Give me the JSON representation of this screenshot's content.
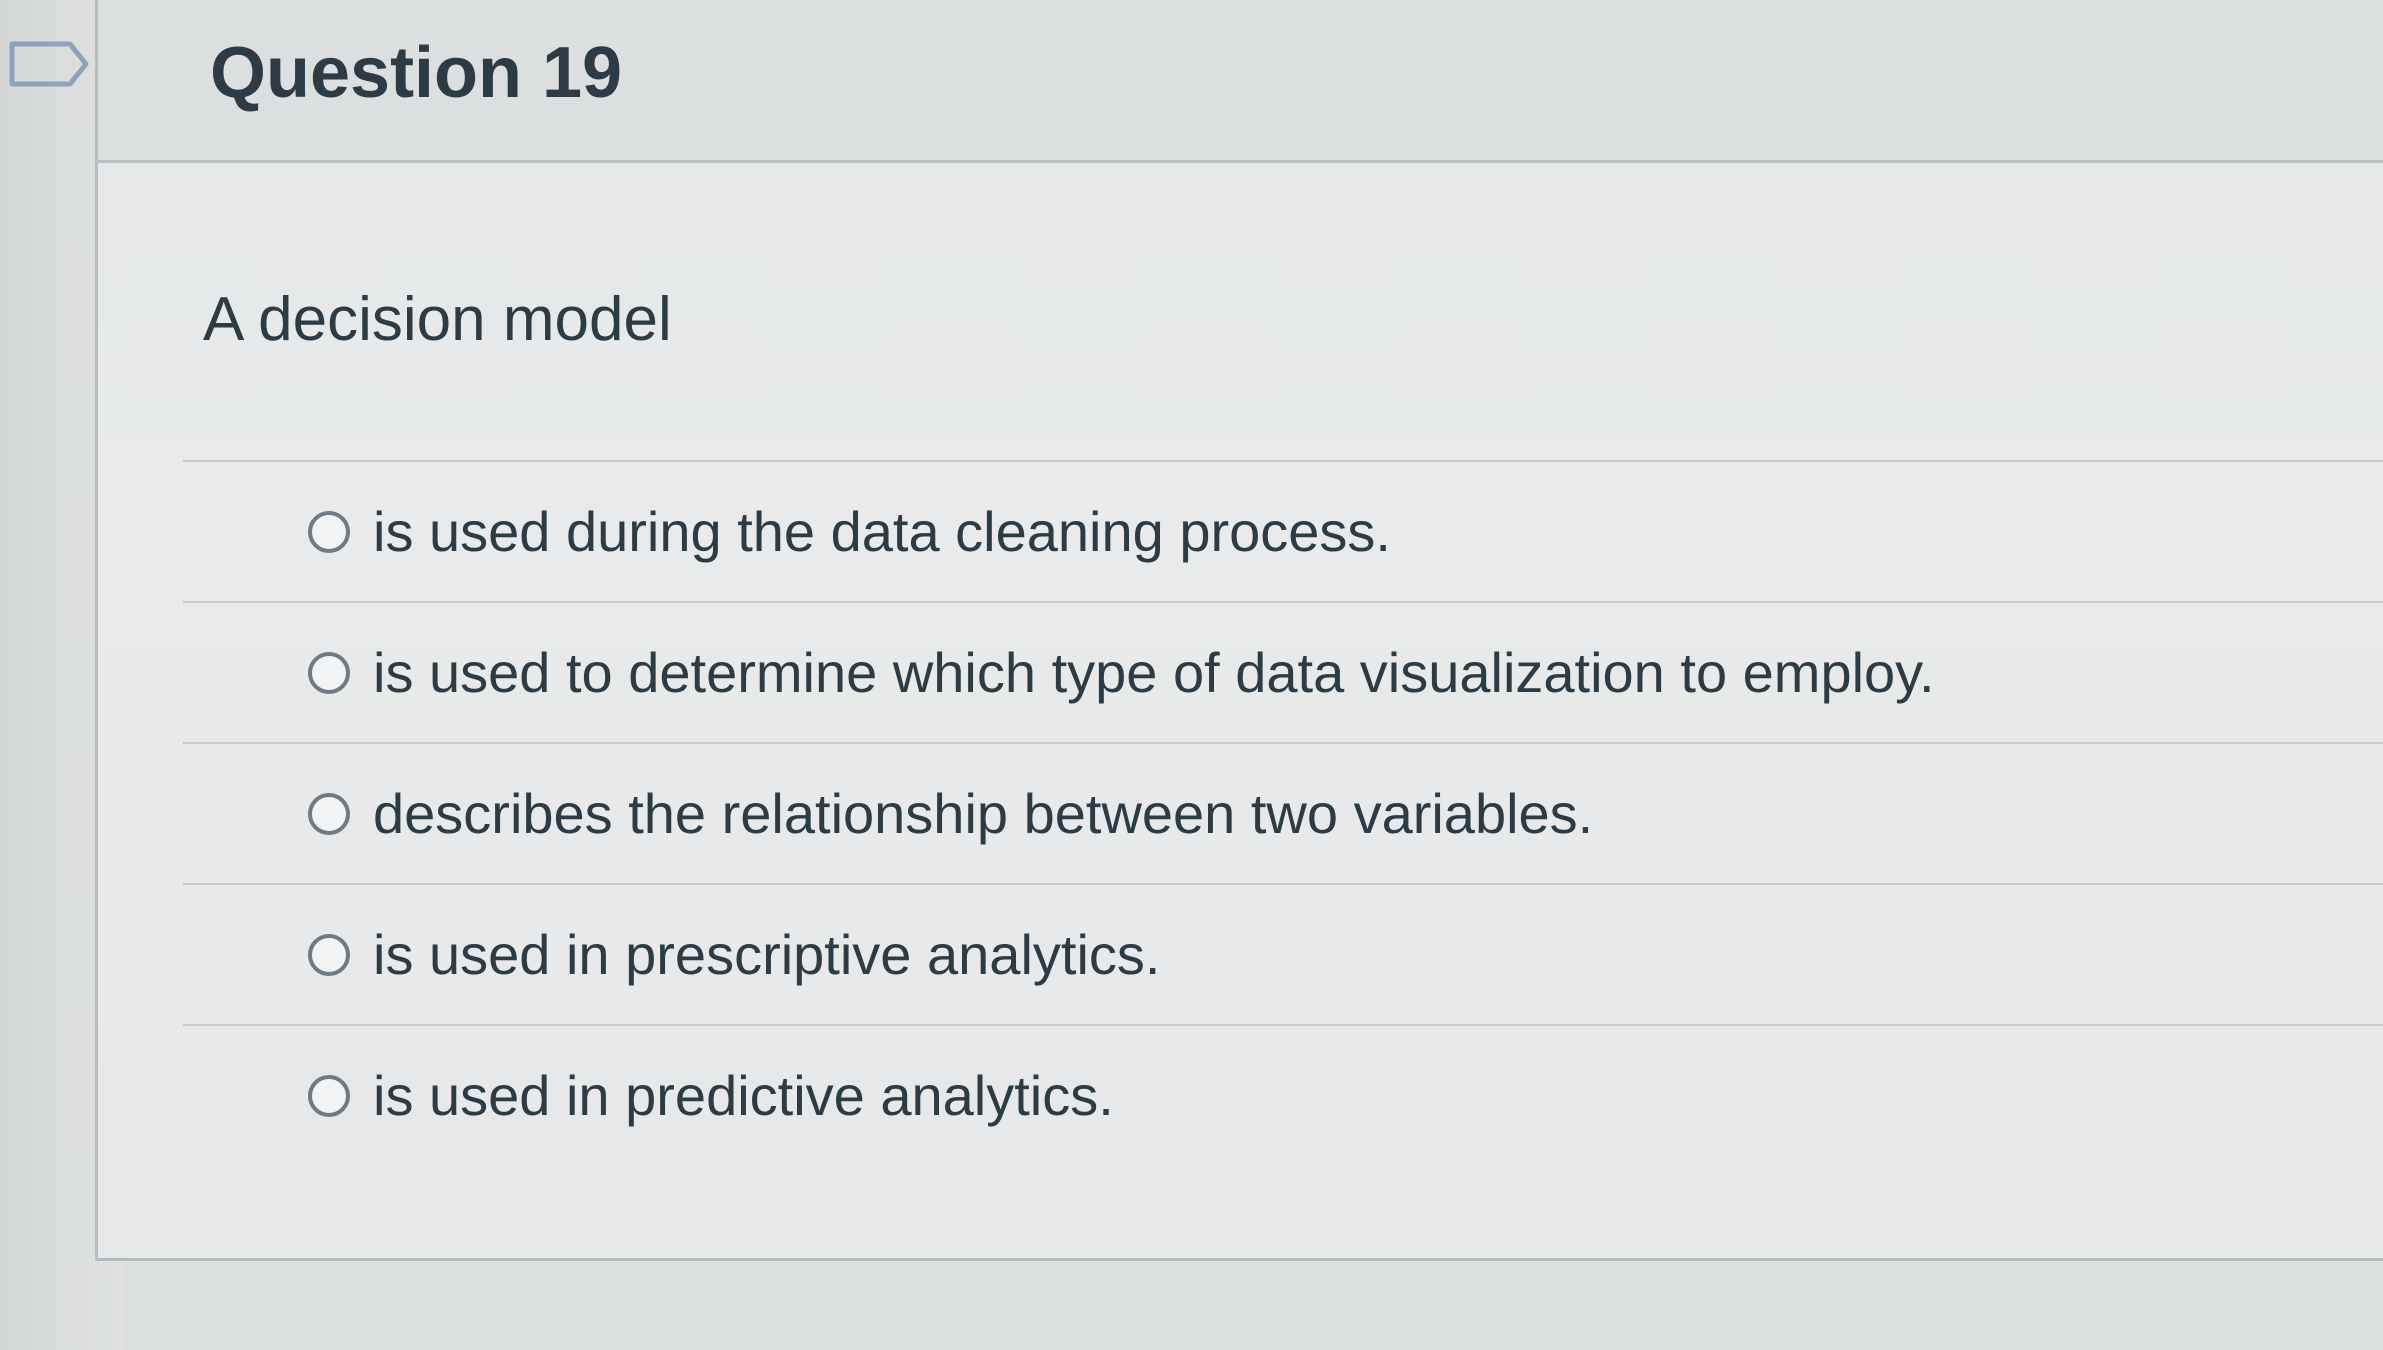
{
  "question": {
    "title": "Question 19",
    "text": "A decision model"
  },
  "answers": [
    {
      "label": "is used during the data cleaning process.",
      "selected": false
    },
    {
      "label": "is used to determine which type of data visualization to employ.",
      "selected": false
    },
    {
      "label": "describes the relationship between two variables.",
      "selected": false
    },
    {
      "label": "is used in prescriptive analytics.",
      "selected": false
    },
    {
      "label": "is used in predictive analytics.",
      "selected": false
    }
  ],
  "icons": {
    "flag": "bookmark-flag-icon",
    "option": "radio-circle-icon"
  },
  "colors": {
    "text": "#2d3b45",
    "radio_border": "#6f7a82",
    "divider": "#c6cacc"
  }
}
